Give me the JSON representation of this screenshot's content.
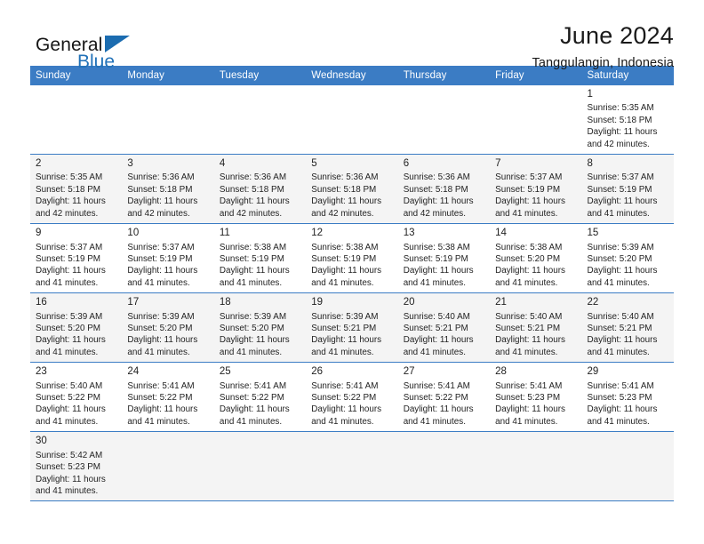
{
  "brand": {
    "name_part1": "General",
    "name_part2": "Blue",
    "mark_icon": "triangle-flag-icon",
    "accent_color": "#1b6cb0"
  },
  "header": {
    "title": "June 2024",
    "subtitle": "Tanggulangin, Indonesia"
  },
  "theme": {
    "header_row_color": "#3b7cc4",
    "row_border_color": "#3b7cc4",
    "shade_color": "#f4f4f4"
  },
  "calendar": {
    "weekday_headers": [
      "Sunday",
      "Monday",
      "Tuesday",
      "Wednesday",
      "Thursday",
      "Friday",
      "Saturday"
    ],
    "weeks": [
      [
        {
          "day": "",
          "lines": []
        },
        {
          "day": "",
          "lines": []
        },
        {
          "day": "",
          "lines": []
        },
        {
          "day": "",
          "lines": []
        },
        {
          "day": "",
          "lines": []
        },
        {
          "day": "",
          "lines": []
        },
        {
          "day": "1",
          "lines": [
            "Sunrise: 5:35 AM",
            "Sunset: 5:18 PM",
            "Daylight: 11 hours",
            "and 42 minutes."
          ]
        }
      ],
      [
        {
          "day": "2",
          "lines": [
            "Sunrise: 5:35 AM",
            "Sunset: 5:18 PM",
            "Daylight: 11 hours",
            "and 42 minutes."
          ]
        },
        {
          "day": "3",
          "lines": [
            "Sunrise: 5:36 AM",
            "Sunset: 5:18 PM",
            "Daylight: 11 hours",
            "and 42 minutes."
          ]
        },
        {
          "day": "4",
          "lines": [
            "Sunrise: 5:36 AM",
            "Sunset: 5:18 PM",
            "Daylight: 11 hours",
            "and 42 minutes."
          ]
        },
        {
          "day": "5",
          "lines": [
            "Sunrise: 5:36 AM",
            "Sunset: 5:18 PM",
            "Daylight: 11 hours",
            "and 42 minutes."
          ]
        },
        {
          "day": "6",
          "lines": [
            "Sunrise: 5:36 AM",
            "Sunset: 5:18 PM",
            "Daylight: 11 hours",
            "and 42 minutes."
          ]
        },
        {
          "day": "7",
          "lines": [
            "Sunrise: 5:37 AM",
            "Sunset: 5:19 PM",
            "Daylight: 11 hours",
            "and 41 minutes."
          ]
        },
        {
          "day": "8",
          "lines": [
            "Sunrise: 5:37 AM",
            "Sunset: 5:19 PM",
            "Daylight: 11 hours",
            "and 41 minutes."
          ]
        }
      ],
      [
        {
          "day": "9",
          "lines": [
            "Sunrise: 5:37 AM",
            "Sunset: 5:19 PM",
            "Daylight: 11 hours",
            "and 41 minutes."
          ]
        },
        {
          "day": "10",
          "lines": [
            "Sunrise: 5:37 AM",
            "Sunset: 5:19 PM",
            "Daylight: 11 hours",
            "and 41 minutes."
          ]
        },
        {
          "day": "11",
          "lines": [
            "Sunrise: 5:38 AM",
            "Sunset: 5:19 PM",
            "Daylight: 11 hours",
            "and 41 minutes."
          ]
        },
        {
          "day": "12",
          "lines": [
            "Sunrise: 5:38 AM",
            "Sunset: 5:19 PM",
            "Daylight: 11 hours",
            "and 41 minutes."
          ]
        },
        {
          "day": "13",
          "lines": [
            "Sunrise: 5:38 AM",
            "Sunset: 5:19 PM",
            "Daylight: 11 hours",
            "and 41 minutes."
          ]
        },
        {
          "day": "14",
          "lines": [
            "Sunrise: 5:38 AM",
            "Sunset: 5:20 PM",
            "Daylight: 11 hours",
            "and 41 minutes."
          ]
        },
        {
          "day": "15",
          "lines": [
            "Sunrise: 5:39 AM",
            "Sunset: 5:20 PM",
            "Daylight: 11 hours",
            "and 41 minutes."
          ]
        }
      ],
      [
        {
          "day": "16",
          "lines": [
            "Sunrise: 5:39 AM",
            "Sunset: 5:20 PM",
            "Daylight: 11 hours",
            "and 41 minutes."
          ]
        },
        {
          "day": "17",
          "lines": [
            "Sunrise: 5:39 AM",
            "Sunset: 5:20 PM",
            "Daylight: 11 hours",
            "and 41 minutes."
          ]
        },
        {
          "day": "18",
          "lines": [
            "Sunrise: 5:39 AM",
            "Sunset: 5:20 PM",
            "Daylight: 11 hours",
            "and 41 minutes."
          ]
        },
        {
          "day": "19",
          "lines": [
            "Sunrise: 5:39 AM",
            "Sunset: 5:21 PM",
            "Daylight: 11 hours",
            "and 41 minutes."
          ]
        },
        {
          "day": "20",
          "lines": [
            "Sunrise: 5:40 AM",
            "Sunset: 5:21 PM",
            "Daylight: 11 hours",
            "and 41 minutes."
          ]
        },
        {
          "day": "21",
          "lines": [
            "Sunrise: 5:40 AM",
            "Sunset: 5:21 PM",
            "Daylight: 11 hours",
            "and 41 minutes."
          ]
        },
        {
          "day": "22",
          "lines": [
            "Sunrise: 5:40 AM",
            "Sunset: 5:21 PM",
            "Daylight: 11 hours",
            "and 41 minutes."
          ]
        }
      ],
      [
        {
          "day": "23",
          "lines": [
            "Sunrise: 5:40 AM",
            "Sunset: 5:22 PM",
            "Daylight: 11 hours",
            "and 41 minutes."
          ]
        },
        {
          "day": "24",
          "lines": [
            "Sunrise: 5:41 AM",
            "Sunset: 5:22 PM",
            "Daylight: 11 hours",
            "and 41 minutes."
          ]
        },
        {
          "day": "25",
          "lines": [
            "Sunrise: 5:41 AM",
            "Sunset: 5:22 PM",
            "Daylight: 11 hours",
            "and 41 minutes."
          ]
        },
        {
          "day": "26",
          "lines": [
            "Sunrise: 5:41 AM",
            "Sunset: 5:22 PM",
            "Daylight: 11 hours",
            "and 41 minutes."
          ]
        },
        {
          "day": "27",
          "lines": [
            "Sunrise: 5:41 AM",
            "Sunset: 5:22 PM",
            "Daylight: 11 hours",
            "and 41 minutes."
          ]
        },
        {
          "day": "28",
          "lines": [
            "Sunrise: 5:41 AM",
            "Sunset: 5:23 PM",
            "Daylight: 11 hours",
            "and 41 minutes."
          ]
        },
        {
          "day": "29",
          "lines": [
            "Sunrise: 5:41 AM",
            "Sunset: 5:23 PM",
            "Daylight: 11 hours",
            "and 41 minutes."
          ]
        }
      ],
      [
        {
          "day": "30",
          "lines": [
            "Sunrise: 5:42 AM",
            "Sunset: 5:23 PM",
            "Daylight: 11 hours",
            "and 41 minutes."
          ]
        },
        {
          "day": "",
          "lines": []
        },
        {
          "day": "",
          "lines": []
        },
        {
          "day": "",
          "lines": []
        },
        {
          "day": "",
          "lines": []
        },
        {
          "day": "",
          "lines": []
        },
        {
          "day": "",
          "lines": []
        }
      ]
    ]
  }
}
